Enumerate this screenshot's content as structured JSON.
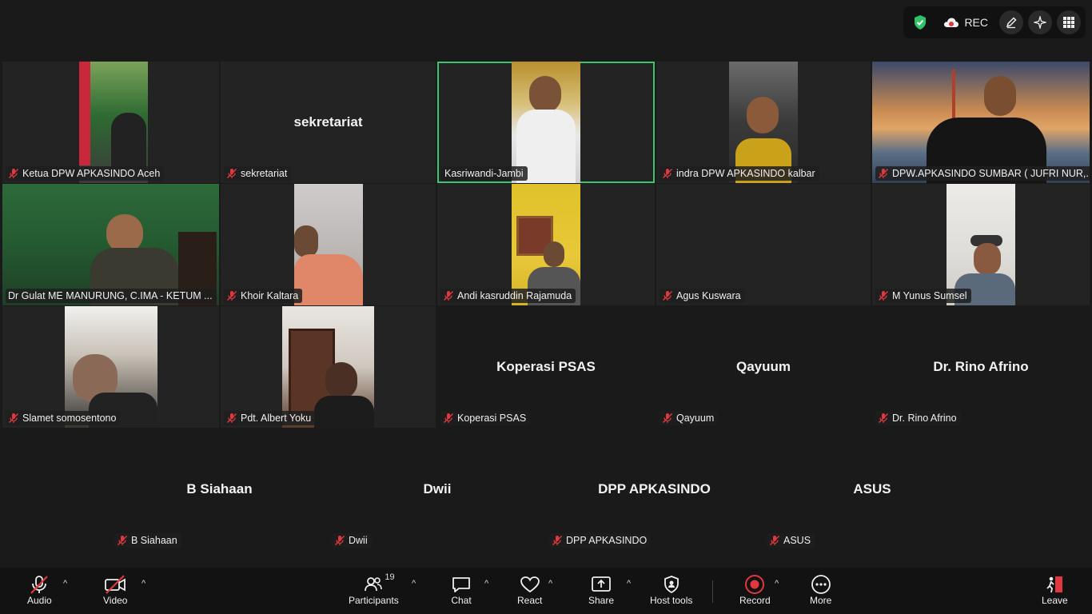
{
  "top_controls": {
    "rec_label": "REC"
  },
  "tiles": {
    "t1": {
      "name": "Ketua DPW APKASINDO Aceh"
    },
    "t2": {
      "name": "sekretariat",
      "big": "sekretariat"
    },
    "t3": {
      "name": "Kasriwandi-Jambi"
    },
    "t4": {
      "name": "indra DPW APKASINDO kalbar"
    },
    "t5": {
      "name": "DPW.APKASINDO SUMBAR ( JUFRI NUR,..."
    },
    "t6": {
      "name": "Dr Gulat ME MANURUNG, C.IMA - KETUM ..."
    },
    "t7": {
      "name": "Khoir Kaltara"
    },
    "t8": {
      "name": "Andi kasruddin Rajamuda"
    },
    "t9": {
      "name": "Agus Kuswara"
    },
    "t10": {
      "name": "M Yunus Sumsel"
    },
    "t11": {
      "name": "Slamet somosentono"
    },
    "t12": {
      "name": "Pdt. Albert Yoku"
    },
    "t13": {
      "name": "Koperasi PSAS",
      "big": "Koperasi PSAS"
    },
    "t14": {
      "name": "Qayuum",
      "big": "Qayuum"
    },
    "t15": {
      "name": "Dr. Rino Afrino",
      "big": "Dr. Rino Afrino"
    },
    "t16": {
      "name": "B Siahaan",
      "big": "B Siahaan"
    },
    "t17": {
      "name": "Dwii",
      "big": "Dwii"
    },
    "t18": {
      "name": "DPP APKASINDO",
      "big": "DPP APKASINDO"
    },
    "t19": {
      "name": "ASUS",
      "big": "ASUS"
    }
  },
  "toolbar": {
    "audio": "Audio",
    "video": "Video",
    "participants": "Participants",
    "participants_count": "19",
    "chat": "Chat",
    "react": "React",
    "share": "Share",
    "host_tools": "Host tools",
    "record": "Record",
    "more": "More",
    "leave": "Leave"
  },
  "colors": {
    "active_speaker": "#3ec46d",
    "muted_icon": "#e0383e",
    "record": "#e0383e",
    "leave": "#e0383e"
  }
}
